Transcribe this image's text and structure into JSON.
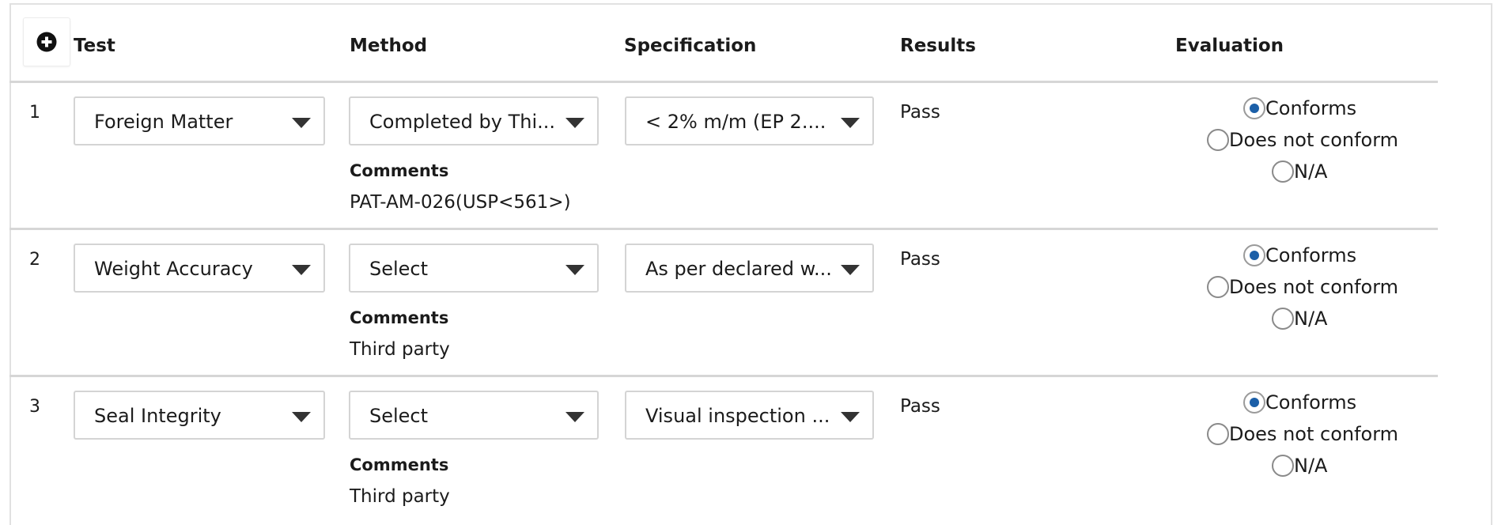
{
  "header": {
    "add_icon": "plus-circle-icon",
    "columns": {
      "test": "Test",
      "method": "Method",
      "specification": "Specification",
      "results": "Results",
      "evaluation": "Evaluation"
    }
  },
  "rows": [
    {
      "num": "1",
      "test": "Foreign Matter",
      "method": "Completed by Thi...",
      "specification": "< 2% m/m (EP 2....",
      "comments_label": "Comments",
      "comments": "PAT-AM-026(USP<561>)",
      "result": "Pass",
      "evaluation": {
        "conforms": "Conforms",
        "does_not_conform": "Does not conform",
        "na": "N/A",
        "selected": "conforms"
      }
    },
    {
      "num": "2",
      "test": "Weight Accuracy",
      "method": "Select",
      "specification": "As per declared w...",
      "comments_label": "Comments",
      "comments": "Third party",
      "result": "Pass",
      "evaluation": {
        "conforms": "Conforms",
        "does_not_conform": "Does not conform",
        "na": "N/A",
        "selected": "conforms"
      }
    },
    {
      "num": "3",
      "test": "Seal Integrity",
      "method": "Select",
      "specification": "Visual inspection ...",
      "comments_label": "Comments",
      "comments": "Third party",
      "result": "Pass",
      "evaluation": {
        "conforms": "Conforms",
        "does_not_conform": "Does not conform",
        "na": "N/A",
        "selected": "conforms"
      }
    }
  ],
  "colors": {
    "radio_selected": "#1b5fa8",
    "border": "#d4d4d4",
    "divider": "#d6d6d6"
  }
}
